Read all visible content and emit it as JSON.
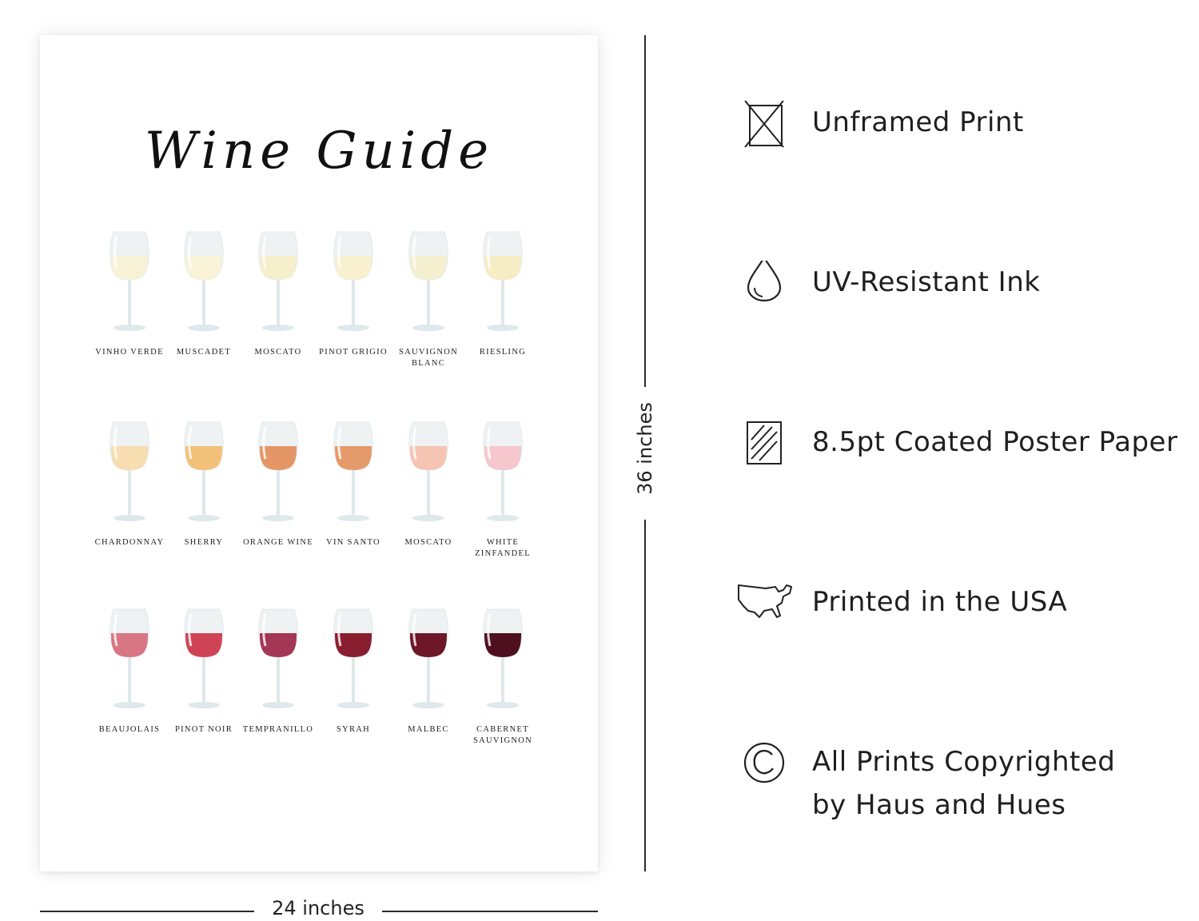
{
  "poster": {
    "title": "Wine Guide",
    "glasses": [
      {
        "label": "VINHO VERDE",
        "color": "#f7f2d6"
      },
      {
        "label": "MUSCADET",
        "color": "#f9f3d8"
      },
      {
        "label": "MOSCATO",
        "color": "#f5efcc"
      },
      {
        "label": "PINOT GRIGIO",
        "color": "#f8f0cf"
      },
      {
        "label": "SAUVIGNON BLANC",
        "color": "#f3efcf"
      },
      {
        "label": "RIESLING",
        "color": "#f7edc4"
      },
      {
        "label": "CHARDONNAY",
        "color": "#f8ddb0"
      },
      {
        "label": "SHERRY",
        "color": "#f2c078"
      },
      {
        "label": "ORANGE WINE",
        "color": "#e49667"
      },
      {
        "label": "VIN SANTO",
        "color": "#e49a6a"
      },
      {
        "label": "MOSCATO",
        "color": "#f6c4b3"
      },
      {
        "label": "WHITE ZINFANDEL",
        "color": "#f6c7cd"
      },
      {
        "label": "BEAUJOLAIS",
        "color": "#d97684"
      },
      {
        "label": "PINOT NOIR",
        "color": "#cf4455"
      },
      {
        "label": "TEMPRANILLO",
        "color": "#a43656"
      },
      {
        "label": "SYRAH",
        "color": "#8a1e31"
      },
      {
        "label": "MALBEC",
        "color": "#6d1728"
      },
      {
        "label": "CABERNET SAUVIGNON",
        "color": "#4f0f1f"
      }
    ]
  },
  "dimensions": {
    "width_label": "24 inches",
    "height_label": "36 inches"
  },
  "features": [
    {
      "icon": "unframed-box-icon",
      "text": "Unframed Print"
    },
    {
      "icon": "ink-drop-icon",
      "text": "UV-Resistant Ink"
    },
    {
      "icon": "paper-sheet-icon",
      "text": "8.5pt Coated Poster Paper"
    },
    {
      "icon": "usa-map-icon",
      "text": "Printed in the USA"
    },
    {
      "icon": "copyright-icon",
      "text_lines": [
        "All Prints Copyrighted",
        "by Haus and Hues"
      ]
    }
  ]
}
